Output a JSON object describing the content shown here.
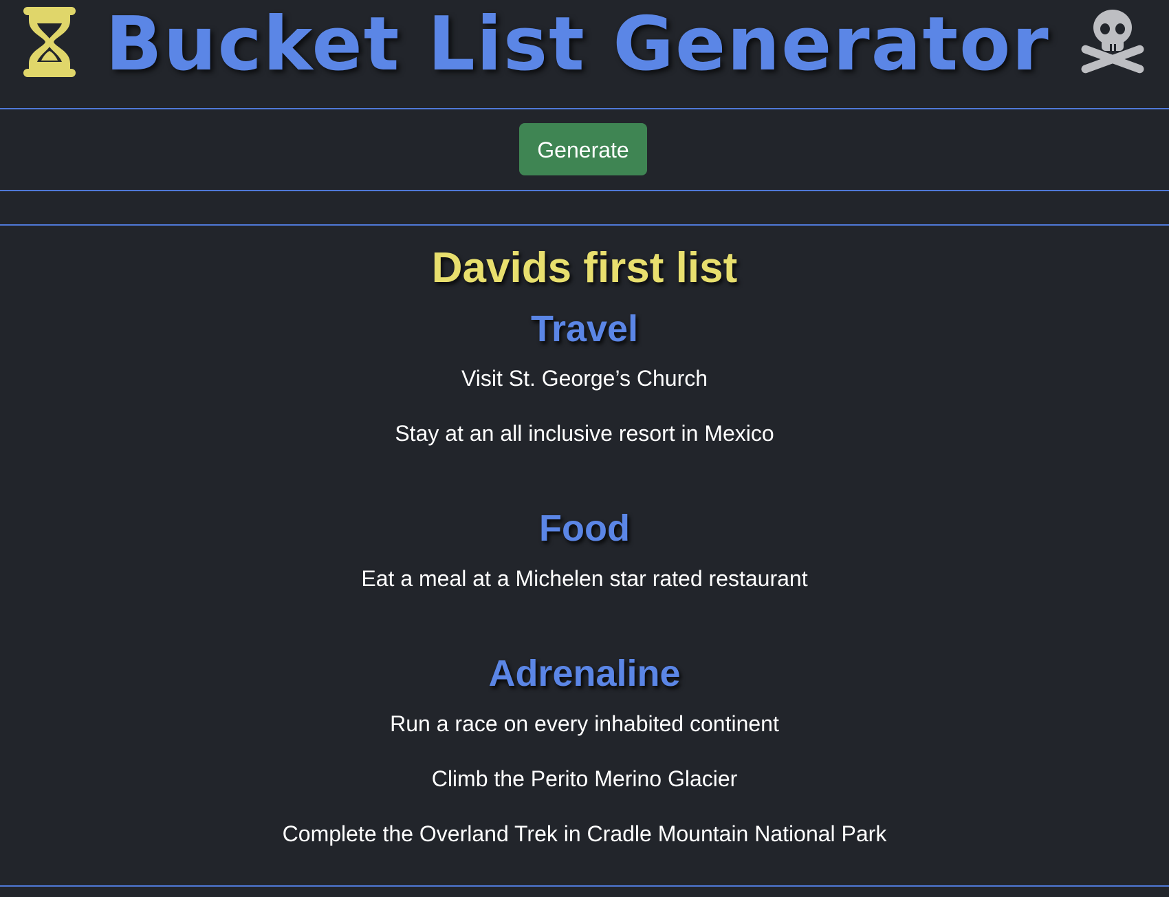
{
  "header": {
    "title": "Bucket List Generator",
    "left_icon": "hourglass-icon",
    "right_icon": "skull-icon"
  },
  "toolbar": {
    "generate_label": "Generate"
  },
  "list": {
    "title": "Davids first list",
    "categories": [
      {
        "name": "Travel",
        "items": [
          "Visit St. George’s Church",
          "Stay at an all inclusive resort in Mexico"
        ]
      },
      {
        "name": "Food",
        "items": [
          "Eat a meal at a Michelen star rated restaurant"
        ]
      },
      {
        "name": "Adrenaline",
        "items": [
          "Run a race on every inhabited continent",
          "Climb the Perito Merino Glacier",
          "Complete the Overland Trek in Cradle Mountain National Park"
        ]
      }
    ]
  },
  "colors": {
    "background": "#22252b",
    "accent_blue": "#5b86e6",
    "title_yellow": "#e8df6e",
    "button_green": "#3f8553",
    "divider": "#4f79d8"
  }
}
